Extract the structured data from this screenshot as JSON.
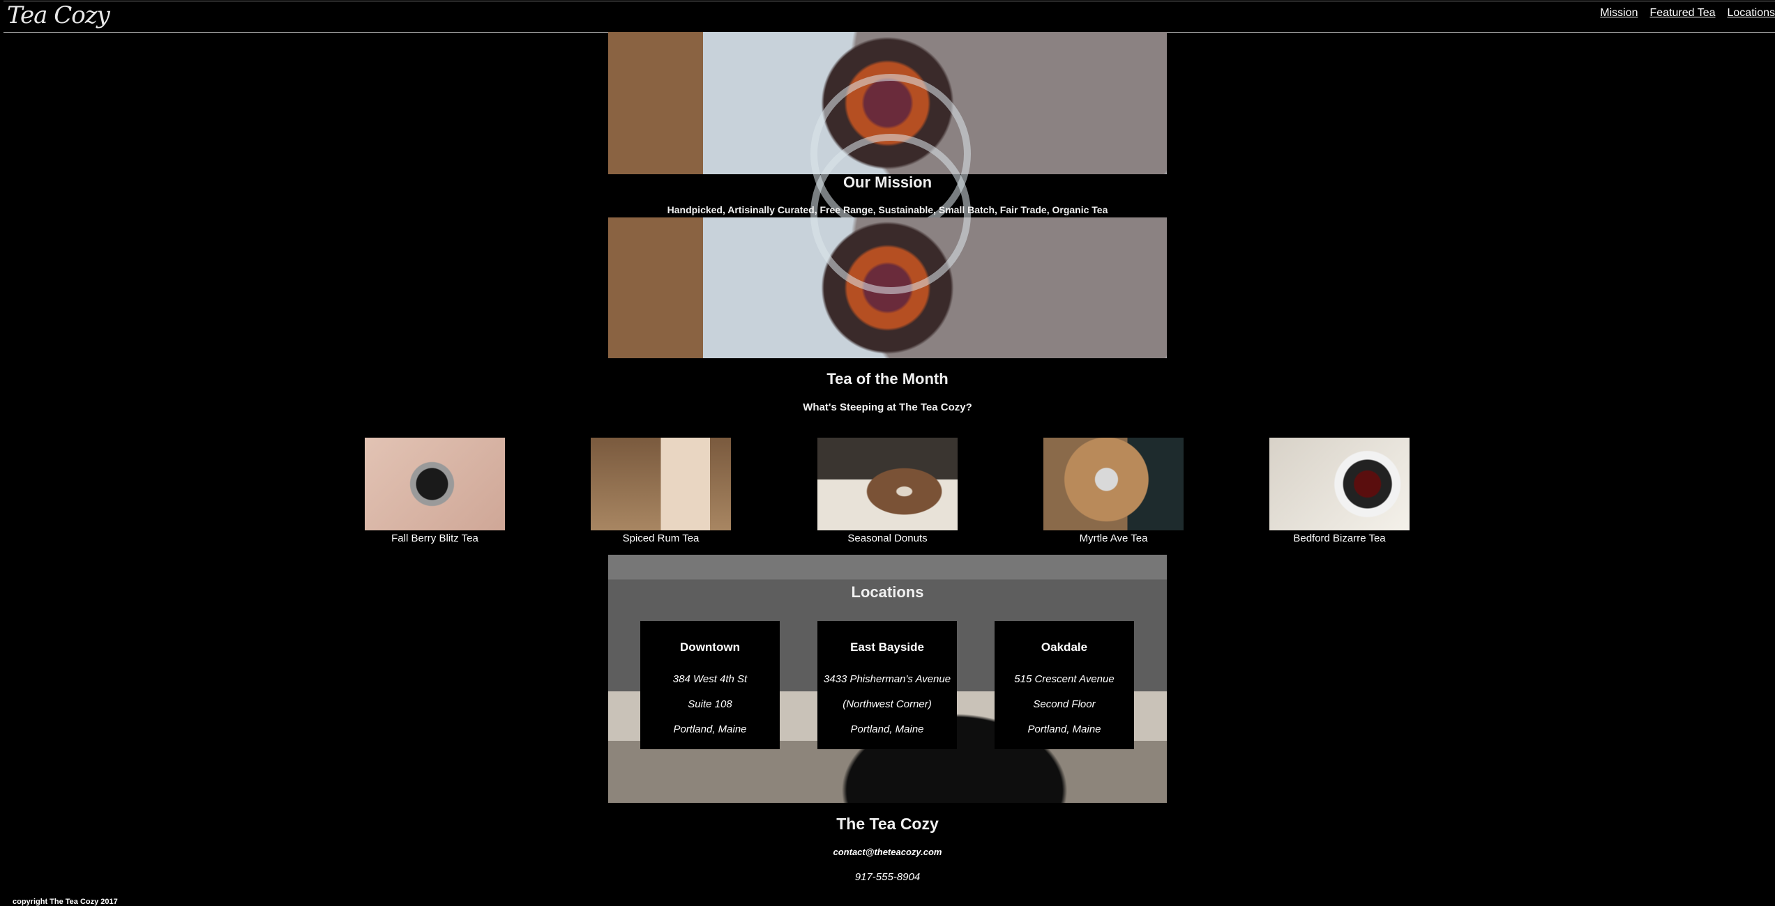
{
  "header": {
    "logo": "Tea Cozy",
    "nav": [
      "Mission",
      "Featured Tea",
      "Locations"
    ]
  },
  "mission": {
    "title": "Our Mission",
    "subtitle": "Handpicked, Artisinally Curated, Free Range, Sustainable, Small Batch, Fair Trade, Organic Tea"
  },
  "featured": {
    "title": "Tea of the Month",
    "subtitle": "What's Steeping at The Tea Cozy?",
    "items": [
      {
        "name": "Fall Berry Blitz Tea"
      },
      {
        "name": "Spiced Rum Tea"
      },
      {
        "name": "Seasonal Donuts"
      },
      {
        "name": "Myrtle Ave Tea"
      },
      {
        "name": "Bedford Bizarre Tea"
      }
    ]
  },
  "locations": {
    "title": "Locations",
    "cards": [
      {
        "name": "Downtown",
        "line1": "384 West 4th St",
        "line2": "Suite 108",
        "line3": "Portland, Maine"
      },
      {
        "name": "East Bayside",
        "line1": "3433 Phisherman's Avenue",
        "line2": "(Northwest Corner)",
        "line3": "Portland, Maine"
      },
      {
        "name": "Oakdale",
        "line1": "515 Crescent Avenue",
        "line2": "Second Floor",
        "line3": "Portland, Maine"
      }
    ]
  },
  "footer": {
    "title": "The Tea Cozy",
    "email": "contact@theteacozy.com",
    "phone": "917-555-8904",
    "copyright": "copyright The Tea Cozy 2017"
  }
}
